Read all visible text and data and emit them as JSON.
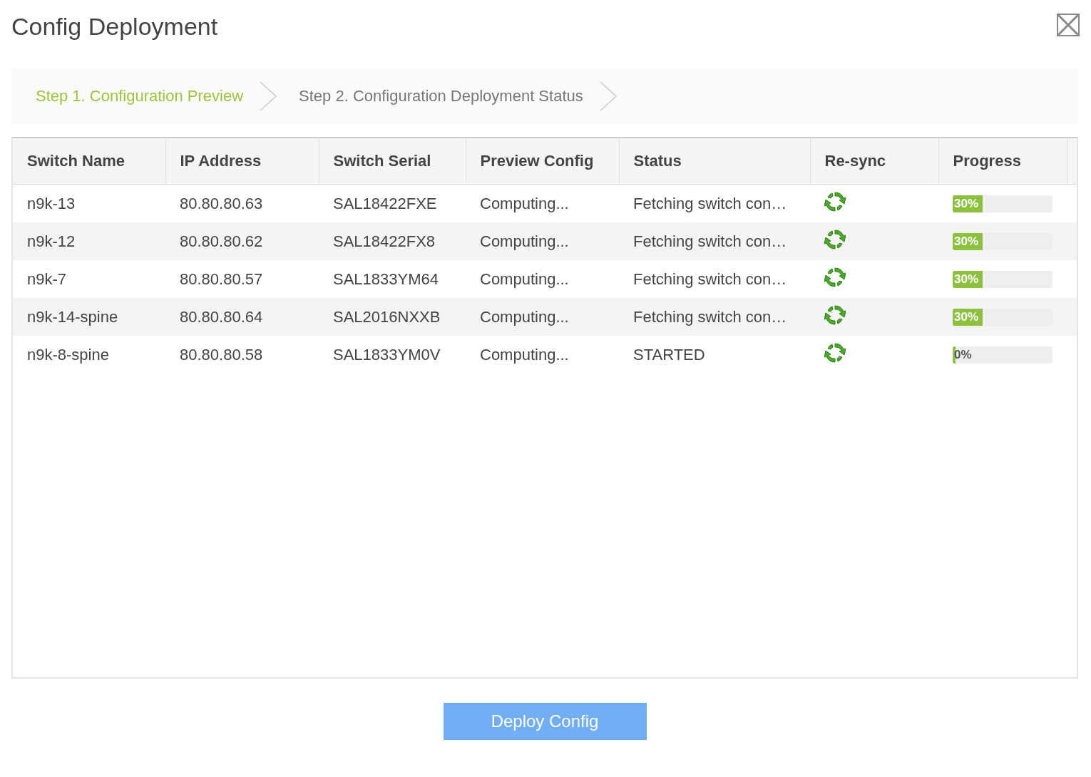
{
  "dialog": {
    "title": "Config Deployment"
  },
  "steps": [
    {
      "label": "Step 1. Configuration Preview",
      "selected": true
    },
    {
      "label": "Step 2. Configuration Deployment Status",
      "selected": false
    }
  ],
  "table": {
    "columns": [
      "Switch Name",
      "IP Address",
      "Switch Serial",
      "Preview Config",
      "Status",
      "Re-sync",
      "Progress"
    ],
    "rows": [
      {
        "name": "n9k-13",
        "ip": "80.80.80.63",
        "serial": "SAL18422FXE",
        "preview": "Computing...",
        "status": "Fetching switch con…",
        "progress": "30%",
        "level": 0.3
      },
      {
        "name": "n9k-12",
        "ip": "80.80.80.62",
        "serial": "SAL18422FX8",
        "preview": "Computing...",
        "status": "Fetching switch con…",
        "progress": "30%",
        "level": 0.3
      },
      {
        "name": "n9k-7",
        "ip": "80.80.80.57",
        "serial": "SAL1833YM64",
        "preview": "Computing...",
        "status": "Fetching switch con…",
        "progress": "30%",
        "level": 0.3
      },
      {
        "name": "n9k-14-spine",
        "ip": "80.80.80.64",
        "serial": "SAL2016NXXB",
        "preview": "Computing...",
        "status": "Fetching switch con…",
        "progress": "30%",
        "level": 0.3
      },
      {
        "name": "n9k-8-spine",
        "ip": "80.80.80.58",
        "serial": "SAL1833YM0V",
        "preview": "Computing...",
        "status": "STARTED",
        "progress": "0%",
        "level": 0.03
      }
    ]
  },
  "deploy_button": {
    "label": "Deploy Config",
    "disabled": true
  }
}
